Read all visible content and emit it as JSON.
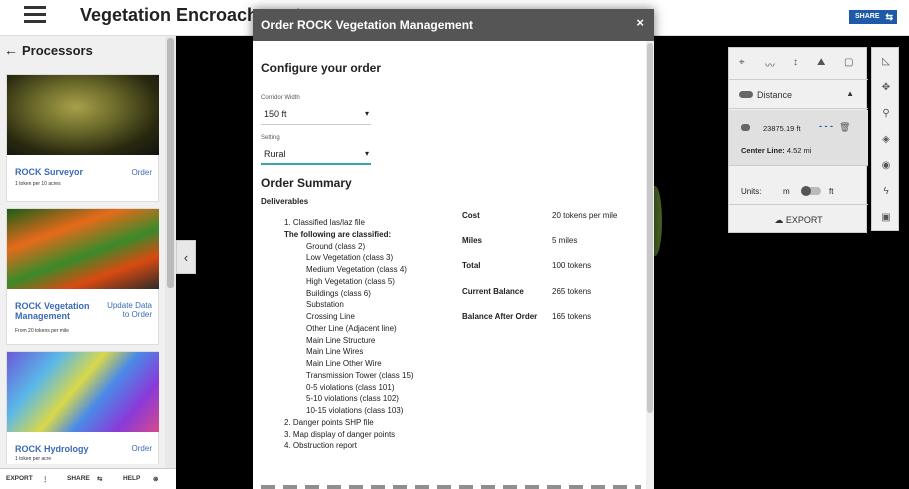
{
  "app": {
    "title": "Vegetation Encroachment",
    "share_label": "SHARE"
  },
  "sidebar": {
    "heading": "Processors",
    "cards": [
      {
        "name": "ROCK Surveyor",
        "price": "1 token per 10 acres",
        "action": "Order"
      },
      {
        "name": "ROCK Vegetation Management",
        "price": "From 20 tokens per mile",
        "action": "Update Data to Order"
      },
      {
        "name": "ROCK Hydrology",
        "price": "1 token per acre",
        "action": "Order"
      }
    ],
    "footer": {
      "export": "EXPORT",
      "share": "SHARE",
      "help": "HELP"
    }
  },
  "measure": {
    "mode_label": "Distance",
    "result_value": "23875.19 ft",
    "center_line_label": "Center Line:",
    "center_line_value": "4.52 mi",
    "units_label": "Units:",
    "unit_left": "m",
    "unit_right": "ft",
    "export_label": "EXPORT"
  },
  "modal": {
    "title": "Order ROCK Vegetation Management",
    "close": "×",
    "configure_title": "Configure your order",
    "corridor_label": "Corridor Width",
    "corridor_value": "150 ft",
    "setting_label": "Setting",
    "setting_value": "Rural",
    "summary_title": "Order Summary",
    "deliverables_label": "Deliverables",
    "item1": "1. Classified las/laz file",
    "classified_header": "The following are classified:",
    "classes": [
      "Ground (class 2)",
      "Low Vegetation (class 3)",
      "Medium Vegetation (class 4)",
      "High Vegetation (class 5)",
      "Buildings (class 6)",
      "Substation",
      "Crossing Line",
      "Other Line (Adjacent line)",
      "Main Line Structure",
      "Main Line Wires",
      "Main Line Other Wire",
      "Transmission Tower (class 15)",
      "0-5 violations (class 101)",
      "5-10 violations (class 102)",
      "10-15 violations (class 103)"
    ],
    "item2": "2. Danger points SHP file",
    "item3": "3. Map display of danger points",
    "item4": "4. Obstruction report",
    "costs": [
      {
        "key": "Cost",
        "value": "20 tokens per mile"
      },
      {
        "key": "Miles",
        "value": "5 miles"
      },
      {
        "key": "Total",
        "value": "100 tokens"
      },
      {
        "key": "Current Balance",
        "value": "265 tokens"
      },
      {
        "key": "Balance After Order",
        "value": "165 tokens"
      }
    ]
  }
}
